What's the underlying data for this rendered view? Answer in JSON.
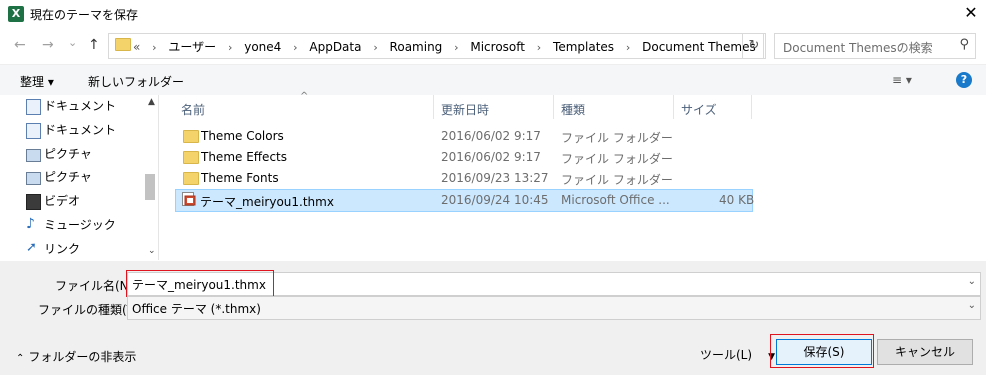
{
  "window": {
    "title": "現在のテーマを保存",
    "app_icon": "X",
    "close": "✕"
  },
  "nav": {
    "back": "←",
    "forward": "→",
    "history": "⌄",
    "up": "↑",
    "breadcrumbs": [
      "«",
      "ユーザー",
      "yone4",
      "AppData",
      "Roaming",
      "Microsoft",
      "Templates",
      "Document Themes"
    ],
    "refresh": "↻",
    "search_placeholder": "Document Themesの検索"
  },
  "toolbar": {
    "organize": "整理 ▾",
    "new_folder": "新しいフォルダー",
    "view_icon": "≡ ▾",
    "help": "?"
  },
  "sidebar": {
    "items": [
      {
        "label": "ドキュメント",
        "icon": "document-icon"
      },
      {
        "label": "ドキュメント",
        "icon": "document-icon"
      },
      {
        "label": "ピクチャ",
        "icon": "picture-icon"
      },
      {
        "label": "ピクチャ",
        "icon": "picture-icon"
      },
      {
        "label": "ビデオ",
        "icon": "video-icon"
      },
      {
        "label": "ミュージック",
        "icon": "music-icon"
      },
      {
        "label": "リンク",
        "icon": "link-icon"
      }
    ]
  },
  "columns": [
    "名前",
    "更新日時",
    "種類",
    "サイズ"
  ],
  "files": [
    {
      "name": "Theme Colors",
      "date": "2016/06/02 9:17",
      "type": "ファイル フォルダー",
      "size": "",
      "icon": "folder-icon"
    },
    {
      "name": "Theme Effects",
      "date": "2016/06/02 9:17",
      "type": "ファイル フォルダー",
      "size": "",
      "icon": "folder-icon"
    },
    {
      "name": "Theme Fonts",
      "date": "2016/09/23 13:27",
      "type": "ファイル フォルダー",
      "size": "",
      "icon": "folder-icon"
    },
    {
      "name": "テーマ_meiryou1.thmx",
      "date": "2016/09/24 10:45",
      "type": "Microsoft Office ...",
      "size": "40 KB",
      "icon": "thmx-file-icon",
      "selected": true
    }
  ],
  "form": {
    "filename_label": "ファイル名(N):",
    "filename_value": "テーマ_meiryou1.thmx",
    "filetype_label": "ファイルの種類(T):",
    "filetype_value": "Office テーマ (*.thmx)"
  },
  "footer": {
    "hide_folders": "フォルダーの非表示",
    "tools": "ツール(L)",
    "save": "保存(S)",
    "cancel": "キャンセル"
  },
  "colors": {
    "selection": "#cce8ff",
    "highlight_border": "#e0141e",
    "help_blue": "#1979ca",
    "excel_green": "#1e7145"
  }
}
